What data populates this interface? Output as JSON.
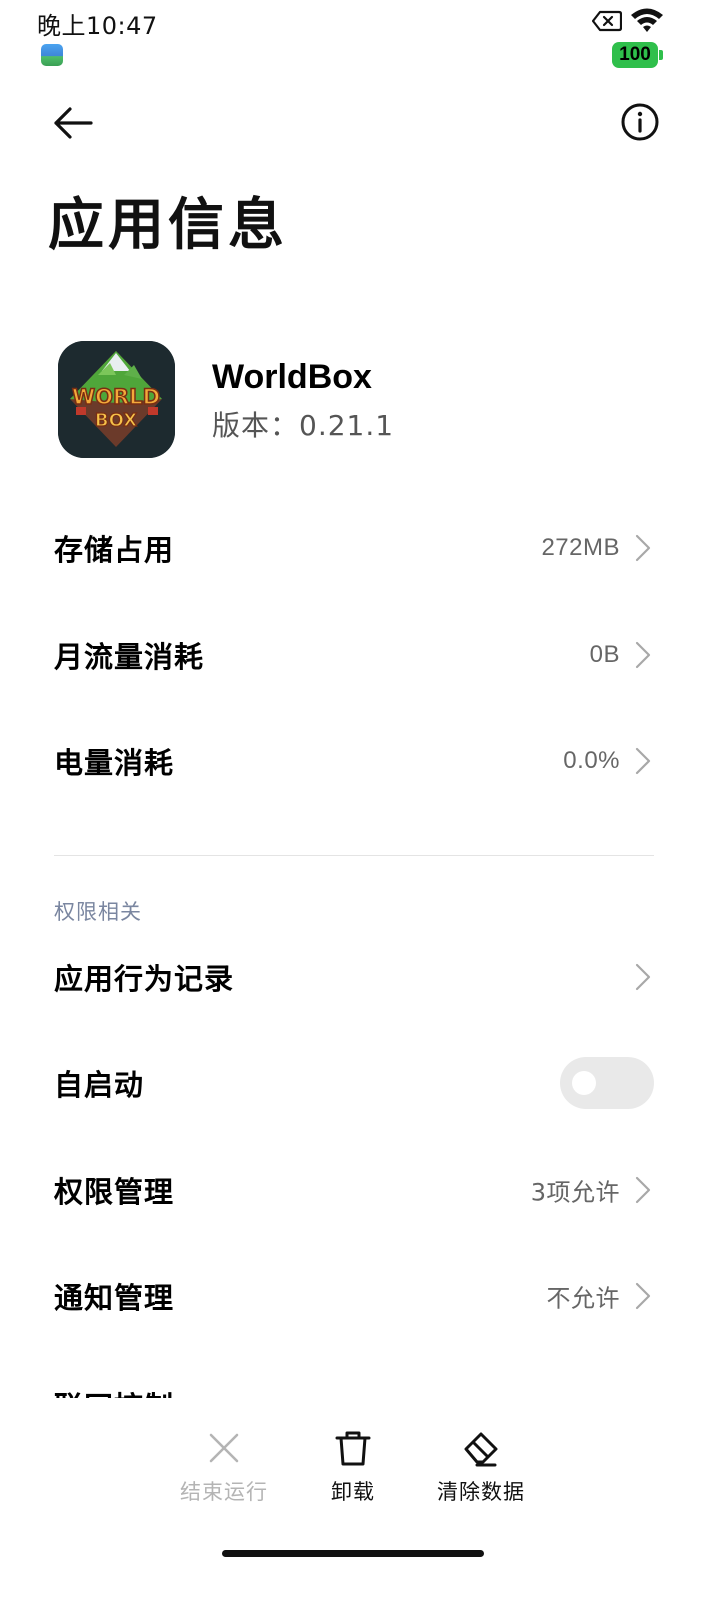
{
  "status_bar": {
    "time": "晚上10:47",
    "battery": "100",
    "battery_color": "#2fbf4b"
  },
  "header": {
    "title": "应用信息"
  },
  "app": {
    "name": "WorldBox",
    "version": "版本：0.21.1",
    "icon_text_line1": "WORLD",
    "icon_text_line2": "BOX"
  },
  "usage_rows": [
    {
      "label": "存储占用",
      "value": "272MB"
    },
    {
      "label": "月流量消耗",
      "value": "0B"
    },
    {
      "label": "电量消耗",
      "value": "0.0%"
    }
  ],
  "permissions": {
    "section_title": "权限相关",
    "behavior_log": {
      "label": "应用行为记录"
    },
    "autostart": {
      "label": "自启动",
      "enabled": false
    },
    "permission_manage": {
      "label": "权限管理",
      "value": "3项允许"
    },
    "notification_manage": {
      "label": "通知管理",
      "value": "不允许"
    },
    "partially_visible_label": "联网控制"
  },
  "bottom_actions": [
    {
      "label": "结束运行",
      "icon": "close-icon",
      "enabled": false
    },
    {
      "label": "卸载",
      "icon": "trash-icon",
      "enabled": true
    },
    {
      "label": "清除数据",
      "icon": "eraser-icon",
      "enabled": true
    }
  ]
}
